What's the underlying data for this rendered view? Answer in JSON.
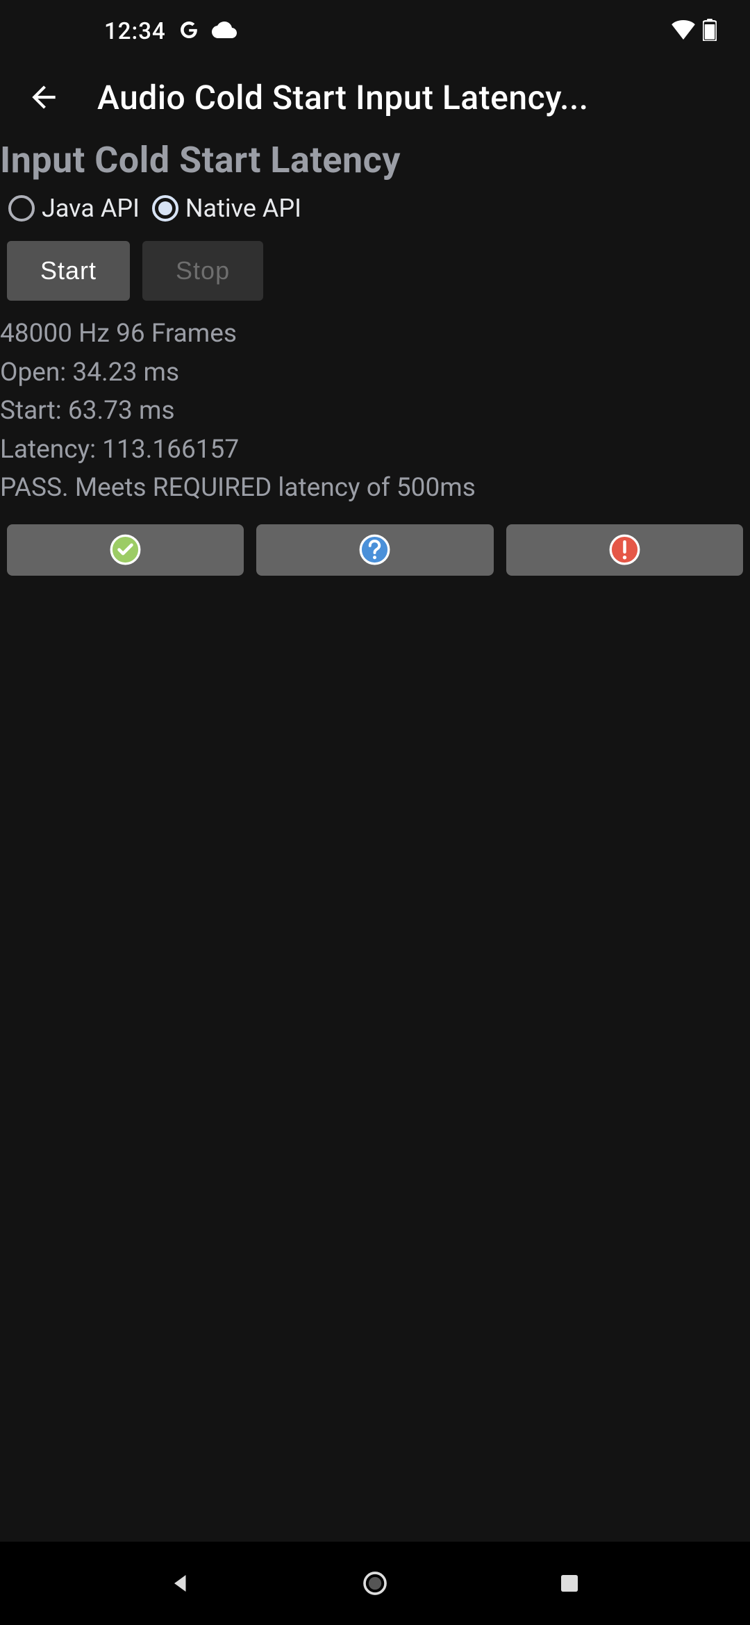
{
  "status_bar": {
    "time": "12:34"
  },
  "app_bar": {
    "title": "Audio Cold Start Input Latency..."
  },
  "section": {
    "heading": "Input Cold Start Latency"
  },
  "radios": {
    "java": {
      "label": "Java API",
      "selected": false
    },
    "native": {
      "label": "Native API",
      "selected": true
    }
  },
  "buttons": {
    "start": {
      "label": "Start",
      "enabled": true
    },
    "stop": {
      "label": "Stop",
      "enabled": false
    }
  },
  "results": {
    "rate_line": "48000 Hz 96 Frames",
    "open_line": "Open: 34.23 ms",
    "start_line": "Start: 63.73 ms",
    "latency_line": "Latency: 113.166157",
    "pass_line": "PASS. Meets REQUIRED latency of 500ms"
  },
  "verdicts": {
    "pass": "pass",
    "info": "info",
    "fail": "fail"
  }
}
